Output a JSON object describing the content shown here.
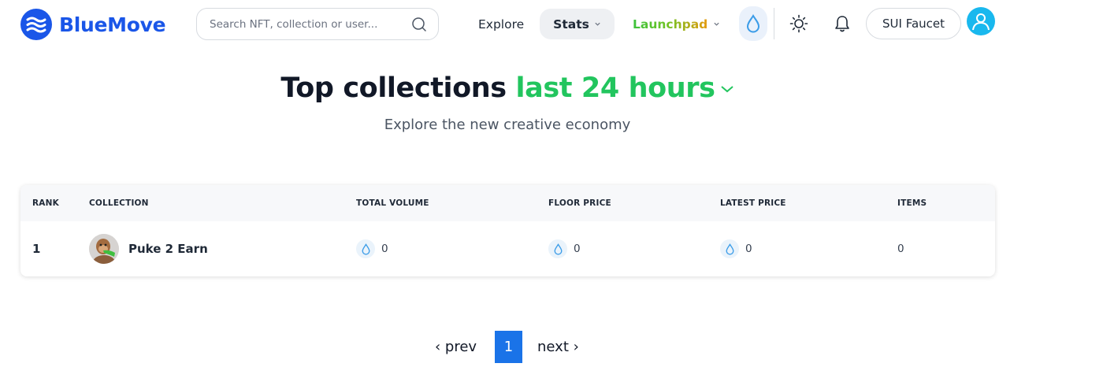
{
  "brand": {
    "name": "BlueMove",
    "color": "#1a56e8"
  },
  "search": {
    "placeholder": "Search NFT, collection or user..."
  },
  "nav": {
    "explore": "Explore",
    "stats": "Stats",
    "launchpad": "Launchpad",
    "faucet": "SUI Faucet"
  },
  "icons": [
    "bluemove-logo-icon",
    "search-icon",
    "chevron-down-icon",
    "sui-drop-icon",
    "sun-icon",
    "bell-icon",
    "user-icon"
  ],
  "heading": {
    "title": "Top collections",
    "period": "last 24 hours",
    "subtitle": "Explore the new creative economy"
  },
  "colors": {
    "accent_green": "#22c55e",
    "primary_blue": "#1a73e8",
    "sui_blue": "#3b9ce8"
  },
  "table": {
    "columns": [
      "RANK",
      "COLLECTION",
      "TOTAL VOLUME",
      "FLOOR PRICE",
      "LATEST PRICE",
      "ITEMS"
    ],
    "rows": [
      {
        "rank": "1",
        "collection": "Puke 2 Earn",
        "total_volume": "0",
        "floor_price": "0",
        "latest_price": "0",
        "items": "0"
      }
    ]
  },
  "pagination": {
    "prev": "prev",
    "current": "1",
    "next": "next"
  }
}
